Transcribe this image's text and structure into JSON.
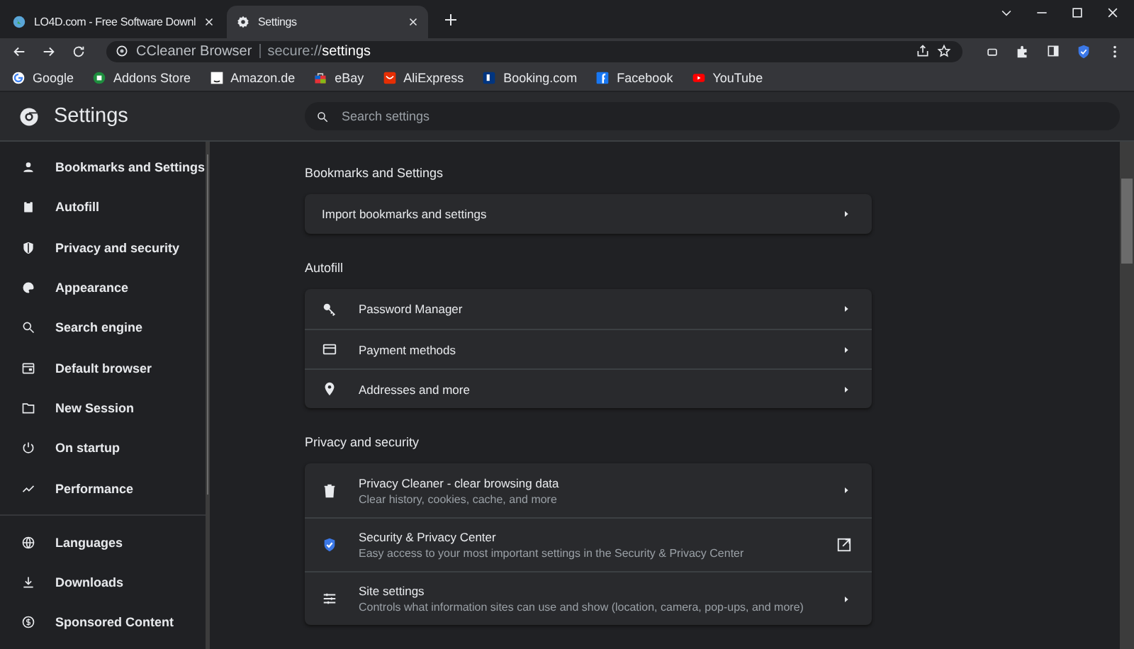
{
  "tabs": [
    {
      "title": "LO4D.com - Free Software Downl",
      "selected": false
    },
    {
      "title": "Settings",
      "selected": true
    }
  ],
  "address": {
    "site_label": "CCleaner Browser",
    "url": "secure://**settings**"
  },
  "bookmarks": [
    {
      "label": "Google"
    },
    {
      "label": "Addons Store"
    },
    {
      "label": "Amazon.de"
    },
    {
      "label": "eBay"
    },
    {
      "label": "AliExpress"
    },
    {
      "label": "Booking.com"
    },
    {
      "label": "Facebook"
    },
    {
      "label": "YouTube"
    }
  ],
  "header": {
    "title": "Settings",
    "search": {
      "placeholder": "Search settings"
    }
  },
  "sidebar": {
    "groups": [
      [
        {
          "label": "Bookmarks and Settings"
        },
        {
          "label": "Autofill"
        },
        {
          "label": "Privacy and security"
        },
        {
          "label": "Appearance"
        },
        {
          "label": "Search engine"
        },
        {
          "label": "Default browser"
        },
        {
          "label": "New Session"
        },
        {
          "label": "On startup"
        },
        {
          "label": "Performance"
        }
      ],
      [
        {
          "label": "Languages"
        },
        {
          "label": "Downloads"
        },
        {
          "label": "Sponsored Content"
        }
      ]
    ]
  },
  "sections": [
    {
      "heading": "Bookmarks and Settings",
      "rows": [
        {
          "title": "Import bookmarks and settings",
          "kind": "submenu"
        }
      ]
    },
    {
      "heading": "Autofill",
      "rows": [
        {
          "title": "Password Manager",
          "kind": "submenu"
        },
        {
          "title": "Payment methods",
          "kind": "submenu"
        },
        {
          "title": "Addresses and more",
          "kind": "submenu"
        }
      ]
    },
    {
      "heading": "Privacy and security",
      "rows": [
        {
          "title": "Privacy Cleaner - clear browsing data",
          "subtitle": "Clear history, cookies, cache, and more",
          "kind": "submenu"
        },
        {
          "title": "Security & Privacy Center",
          "subtitle": "Easy access to your most important settings in the Security & Privacy Center",
          "kind": "external"
        },
        {
          "title": "Site settings",
          "subtitle": "Controls what information sites can use and show (location, camera, pop-ups, and more)",
          "kind": "submenu"
        }
      ]
    }
  ]
}
